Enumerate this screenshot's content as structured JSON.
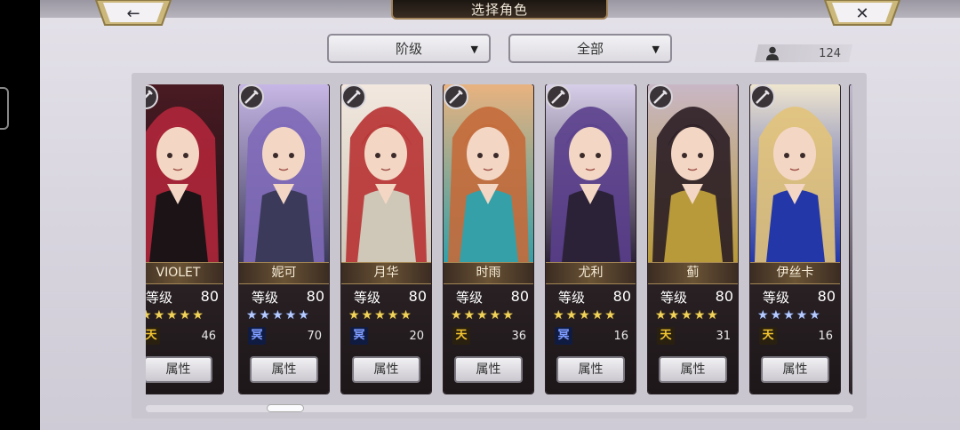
{
  "header": {
    "title": "选择角色",
    "back_icon": "←",
    "close_icon": "✕"
  },
  "filters": {
    "rank_label": "阶级",
    "category_label": "全部",
    "caret": "▼"
  },
  "roster_count": "124",
  "attr_label": "属性",
  "level_label": "等级",
  "characters": [
    {
      "name": "VIOLET",
      "level": "80",
      "star_color": "gold",
      "tier_glyph": "天",
      "tier_color": "gold",
      "tier_num": "46",
      "theme": [
        "#4a1a22",
        "#b0263a",
        "#1b1316"
      ]
    },
    {
      "name": "妮可",
      "level": "80",
      "star_color": "blue",
      "tier_glyph": "冥",
      "tier_color": "blue",
      "tier_num": "70",
      "theme": [
        "#c7b7e6",
        "#7e69b8",
        "#3b3a5a"
      ]
    },
    {
      "name": "月华",
      "level": "80",
      "star_color": "gold",
      "tier_glyph": "冥",
      "tier_color": "blue",
      "tier_num": "20",
      "theme": [
        "#f2e8df",
        "#b73232",
        "#cfc7b8"
      ]
    },
    {
      "name": "时雨",
      "level": "80",
      "star_color": "gold",
      "tier_glyph": "天",
      "tier_color": "gold",
      "tier_num": "36",
      "theme": [
        "#e9b27f",
        "#c56a3a",
        "#35a0a8"
      ]
    },
    {
      "name": "尤利",
      "level": "80",
      "star_color": "gold",
      "tier_glyph": "冥",
      "tier_color": "blue",
      "tier_num": "16",
      "theme": [
        "#d7cfe9",
        "#5a3f8c",
        "#2c2238"
      ]
    },
    {
      "name": "蓟",
      "level": "80",
      "star_color": "gold",
      "tier_glyph": "天",
      "tier_color": "gold",
      "tier_num": "31",
      "theme": [
        "#c9b7c6",
        "#2a1d24",
        "#b89a3a"
      ]
    },
    {
      "name": "伊丝卡",
      "level": "80",
      "star_color": "blue",
      "tier_glyph": "天",
      "tier_color": "gold",
      "tier_num": "16",
      "theme": [
        "#f0e6cf",
        "#e2c37a",
        "#2337a8"
      ]
    }
  ]
}
